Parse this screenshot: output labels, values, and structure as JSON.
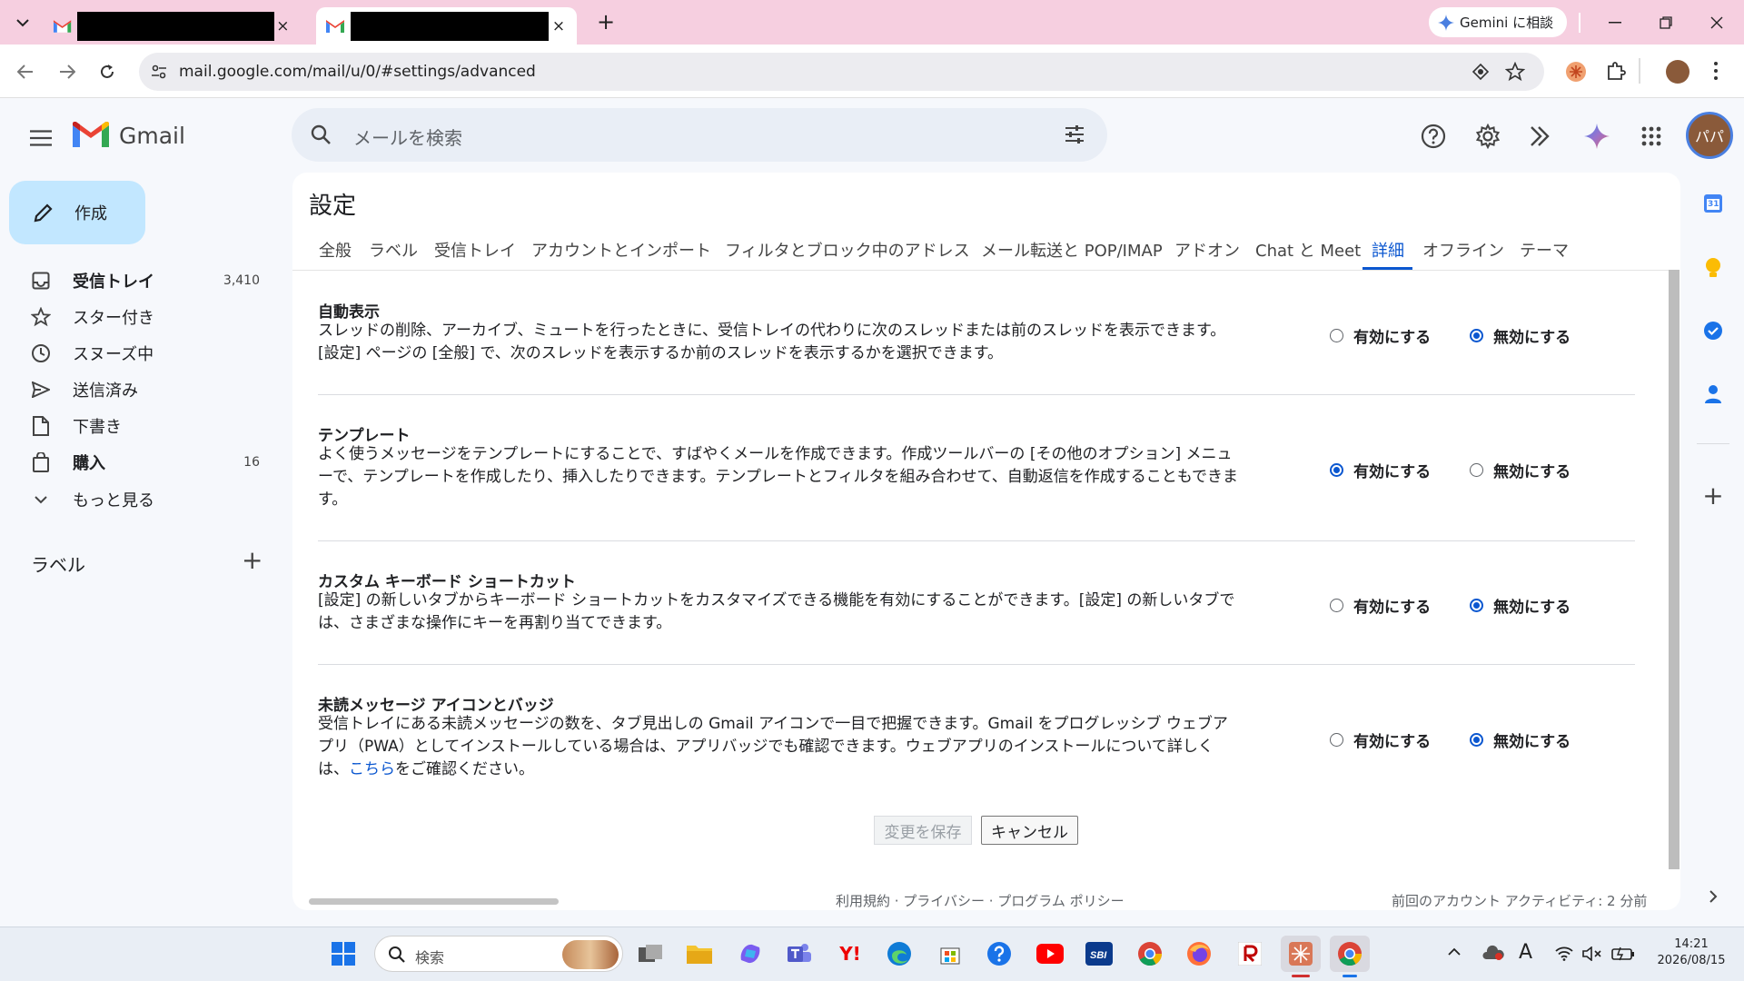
{
  "browser": {
    "new_tab_symbol": "+",
    "tab_close_symbol": "×",
    "gemini_button": "Gemini に相談",
    "url": "mail.google.com/mail/u/0/#settings/advanced"
  },
  "gmail": {
    "brand": "Gmail",
    "search_placeholder": "メールを検索",
    "avatar_text": "パパ"
  },
  "sidebar": {
    "compose": "作成",
    "items": [
      {
        "label": "受信トレイ",
        "count": "3,410",
        "icon": "inbox-icon",
        "bold": true
      },
      {
        "label": "スター付き",
        "count": "",
        "icon": "star-icon",
        "bold": false
      },
      {
        "label": "スヌーズ中",
        "count": "",
        "icon": "clock-icon",
        "bold": false
      },
      {
        "label": "送信済み",
        "count": "",
        "icon": "send-icon",
        "bold": false
      },
      {
        "label": "下書き",
        "count": "",
        "icon": "draft-icon",
        "bold": false
      },
      {
        "label": "購入",
        "count": "16",
        "icon": "bag-icon",
        "bold": true
      },
      {
        "label": "もっと見る",
        "count": "",
        "icon": "chevron-down-icon",
        "bold": false
      }
    ],
    "labels_heading": "ラベル",
    "labels_add": "+"
  },
  "settings": {
    "title": "設定",
    "tabs": [
      "全般",
      "ラベル",
      "受信トレイ",
      "アカウントとインポート",
      "フィルタとブロック中のアドレス",
      "メール転送と POP/IMAP",
      "アドオン",
      "Chat と Meet",
      "詳細",
      "オフライン",
      "テーマ"
    ],
    "active_tab": "詳細",
    "enable_label": "有効にする",
    "disable_label": "無効にする",
    "sections": [
      {
        "title": "自動表示",
        "desc": "スレッドの削除、アーカイブ、ミュートを行ったときに、受信トレイの代わりに次のスレッドまたは前のスレッドを表示できます。[設定] ページの [全般] で、次のスレッドを表示するか前のスレッドを表示するかを選択できます。",
        "selected": "disable"
      },
      {
        "title": "テンプレート",
        "desc": "よく使うメッセージをテンプレートにすることで、すばやくメールを作成できます。作成ツールバーの [その他のオプション] メニューで、テンプレートを作成したり、挿入したりできます。テンプレートとフィルタを組み合わせて、自動返信を作成することもできます。",
        "selected": "enable"
      },
      {
        "title": "カスタム キーボード ショートカット",
        "desc": "[設定] の新しいタブからキーボード ショートカットをカスタマイズできる機能を有効にすることができます。[設定] の新しいタブでは、さまざまな操作にキーを再割り当てできます。",
        "selected": "disable"
      },
      {
        "title": "未読メッセージ アイコンとバッジ",
        "desc": "受信トレイにある未読メッセージの数を、タブ見出しの Gmail アイコンで一目で把握できます。Gmail をプログレッシブ ウェブアプリ（PWA）としてインストールしている場合は、アプリバッジでも確認できます。ウェブアプリのインストールについて詳しくは、",
        "link": "こちら",
        "desc_after": "をご確認ください。",
        "selected": "disable"
      }
    ],
    "save_button": "変更を保存",
    "cancel_button": "キャンセル",
    "footer_links": "利用規約 · プライバシー · プログラム ポリシー",
    "last_activity": "前回のアカウント アクティビティ: 2 分前"
  },
  "side_panel": {
    "calendar_day": "31",
    "add_symbol": "+"
  },
  "taskbar": {
    "search_placeholder": "検索",
    "time": "14:21",
    "date": "2026/08/15",
    "ime_symbol": "A"
  },
  "colors": {
    "titlebar": "#f6cfe0",
    "accent": "#0b57d0",
    "compose": "#c2e7ff"
  }
}
